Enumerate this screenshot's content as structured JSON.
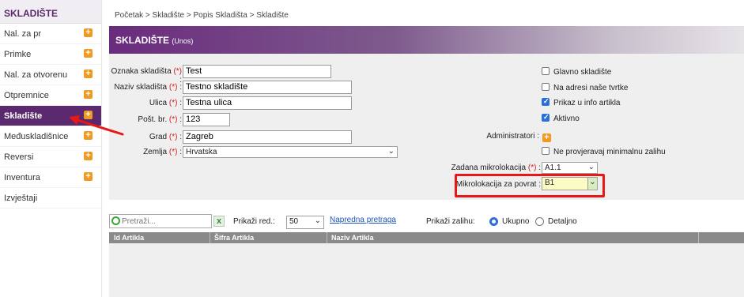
{
  "sidebar": {
    "title": "SKLADIŠTE",
    "items": [
      {
        "label": "Nal. za pr",
        "plus": true
      },
      {
        "label": "Primke",
        "plus": true
      },
      {
        "label": "Nal. za otvorenu",
        "plus": true
      },
      {
        "label": "Otpremnice",
        "plus": true
      },
      {
        "label": "Skladište",
        "plus": true,
        "active": true
      },
      {
        "label": "Međuskladišnice",
        "plus": true
      },
      {
        "label": "Reversi",
        "plus": true
      },
      {
        "label": "Inventura",
        "plus": true
      },
      {
        "label": "Izvještaji",
        "plus": false
      }
    ]
  },
  "breadcrumb": "Početak  >  Skladište  >  Popis Skladišta  >  Skladište",
  "panel": {
    "title": "SKLADIŠTE",
    "subtitle": "(Unos)"
  },
  "form": {
    "required_mark": "(*)",
    "oznaka": {
      "label": "Oznaka skladišta",
      "value": "Test"
    },
    "naziv": {
      "label": "Naziv skladišta",
      "value": "Testno skladište"
    },
    "ulica": {
      "label": "Ulica",
      "value": "Testna ulica"
    },
    "post": {
      "label": "Pošt. br.",
      "value": "123"
    },
    "grad": {
      "label": "Grad",
      "value": "Zagreb"
    },
    "zemlja": {
      "label": "Zemlja",
      "value": "Hrvatska"
    },
    "glavno": {
      "label": "Glavno skladište",
      "checked": false
    },
    "adresi": {
      "label": "Na adresi naše tvrtke",
      "checked": false
    },
    "prikaz_info": {
      "label": "Prikaz u info artikla",
      "checked": true
    },
    "aktivno": {
      "label": "Aktivno",
      "checked": true
    },
    "administratori": {
      "label": "Administratori :"
    },
    "ne_provjeravaj": {
      "label": "Ne provjeravaj minimalnu zalihu",
      "checked": false
    },
    "zadana": {
      "label": "Zadana mikrolokacija",
      "value": "A1.1"
    },
    "povrat": {
      "label": "Mikrolokacija za povrat :",
      "value": "B1"
    },
    "colon": ":"
  },
  "toolbar": {
    "search_placeholder": "Pretraži...",
    "clear_label": "x",
    "prikazi_red": "Prikaži red.:",
    "page_size": "50",
    "napredna": "Napredna pretraga",
    "prikazi_zalihu": "Prikaži zalihu:",
    "ukupno": "Ukupno",
    "detaljno": "Detaljno"
  },
  "grid": {
    "columns": [
      "Id Artikla",
      "Šifra Artikla",
      "Naziv Artikla"
    ]
  },
  "colors": {
    "brand": "#5b2a6e",
    "accent": "#f29a1f",
    "highlight": "#e81818",
    "checkbox": "#2d6fd8"
  }
}
